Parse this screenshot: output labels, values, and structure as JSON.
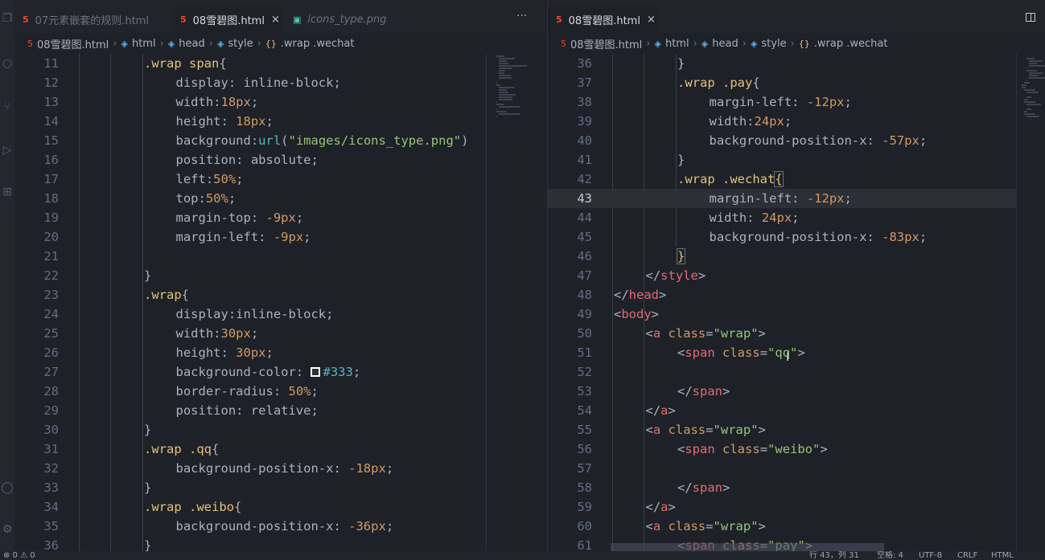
{
  "left_pane": {
    "tabs": [
      {
        "label": "07元素嵌套的规则.html",
        "icon": "html5-icon",
        "active": false
      },
      {
        "label": "08雪碧图.html",
        "icon": "html5-icon",
        "active": true,
        "close": "×"
      },
      {
        "label": "icons_type.png",
        "icon": "image-icon",
        "active": false,
        "italic": true
      }
    ],
    "more": "···",
    "breadcrumbs": [
      "08雪碧图.html",
      "html",
      "head",
      "style",
      ".wrap .wechat"
    ],
    "lines": [
      {
        "n": "11",
        "indent": 2,
        "tokens": [
          {
            "t": ".wrap span",
            "c": "sel"
          },
          {
            "t": "{",
            "c": "prop"
          }
        ]
      },
      {
        "n": "12",
        "indent": 3,
        "tokens": [
          {
            "t": "display: inline-block;",
            "c": "prop"
          }
        ]
      },
      {
        "n": "13",
        "indent": 3,
        "tokens": [
          {
            "t": "width:",
            "c": "prop"
          },
          {
            "t": "18px",
            "c": "num"
          },
          {
            "t": ";",
            "c": "prop"
          }
        ]
      },
      {
        "n": "14",
        "indent": 3,
        "tokens": [
          {
            "t": "height: ",
            "c": "prop"
          },
          {
            "t": "18px",
            "c": "num"
          },
          {
            "t": ";",
            "c": "prop"
          }
        ]
      },
      {
        "n": "15",
        "indent": 3,
        "tokens": [
          {
            "t": "background:",
            "c": "prop"
          },
          {
            "t": "url",
            "c": "kw"
          },
          {
            "t": "(",
            "c": "prop"
          },
          {
            "t": "\"images/icons_type.png\"",
            "c": "str"
          },
          {
            "t": ")",
            "c": "prop"
          }
        ]
      },
      {
        "n": "16",
        "indent": 3,
        "tokens": [
          {
            "t": "position: absolute;",
            "c": "prop"
          }
        ]
      },
      {
        "n": "17",
        "indent": 3,
        "tokens": [
          {
            "t": "left:",
            "c": "prop"
          },
          {
            "t": "50%",
            "c": "num"
          },
          {
            "t": ";",
            "c": "prop"
          }
        ]
      },
      {
        "n": "18",
        "indent": 3,
        "tokens": [
          {
            "t": "top:",
            "c": "prop"
          },
          {
            "t": "50%",
            "c": "num"
          },
          {
            "t": ";",
            "c": "prop"
          }
        ]
      },
      {
        "n": "19",
        "indent": 3,
        "tokens": [
          {
            "t": "margin-top: ",
            "c": "prop"
          },
          {
            "t": "-9px",
            "c": "num"
          },
          {
            "t": ";",
            "c": "prop"
          }
        ]
      },
      {
        "n": "20",
        "indent": 3,
        "tokens": [
          {
            "t": "margin-left: ",
            "c": "prop"
          },
          {
            "t": "-9px",
            "c": "num"
          },
          {
            "t": ";",
            "c": "prop"
          }
        ]
      },
      {
        "n": "21",
        "indent": 0,
        "tokens": []
      },
      {
        "n": "22",
        "indent": 2,
        "tokens": [
          {
            "t": "}",
            "c": "prop"
          }
        ]
      },
      {
        "n": "23",
        "indent": 2,
        "tokens": [
          {
            "t": ".wrap",
            "c": "sel"
          },
          {
            "t": "{",
            "c": "prop"
          }
        ]
      },
      {
        "n": "24",
        "indent": 3,
        "tokens": [
          {
            "t": "display:inline-block;",
            "c": "prop"
          }
        ]
      },
      {
        "n": "25",
        "indent": 3,
        "tokens": [
          {
            "t": "width:",
            "c": "prop"
          },
          {
            "t": "30px",
            "c": "num"
          },
          {
            "t": ";",
            "c": "prop"
          }
        ]
      },
      {
        "n": "26",
        "indent": 3,
        "tokens": [
          {
            "t": "height: ",
            "c": "prop"
          },
          {
            "t": "30px",
            "c": "num"
          },
          {
            "t": ";",
            "c": "prop"
          }
        ]
      },
      {
        "n": "27",
        "indent": 3,
        "tokens": [
          {
            "t": "background-color: ",
            "c": "prop"
          },
          {
            "t": "",
            "c": "swatch"
          },
          {
            "t": "#333",
            "c": "kw"
          },
          {
            "t": ";",
            "c": "prop"
          }
        ]
      },
      {
        "n": "28",
        "indent": 3,
        "tokens": [
          {
            "t": "border-radius: ",
            "c": "prop"
          },
          {
            "t": "50%",
            "c": "num"
          },
          {
            "t": ";",
            "c": "prop"
          }
        ]
      },
      {
        "n": "29",
        "indent": 3,
        "tokens": [
          {
            "t": "position: relative;",
            "c": "prop"
          }
        ]
      },
      {
        "n": "30",
        "indent": 2,
        "tokens": [
          {
            "t": "}",
            "c": "prop"
          }
        ]
      },
      {
        "n": "31",
        "indent": 2,
        "tokens": [
          {
            "t": ".wrap .qq",
            "c": "sel"
          },
          {
            "t": "{",
            "c": "prop"
          }
        ]
      },
      {
        "n": "32",
        "indent": 3,
        "tokens": [
          {
            "t": "background-position-x: ",
            "c": "prop"
          },
          {
            "t": "-18px",
            "c": "num"
          },
          {
            "t": ";",
            "c": "prop"
          }
        ]
      },
      {
        "n": "33",
        "indent": 2,
        "tokens": [
          {
            "t": "}",
            "c": "prop"
          }
        ]
      },
      {
        "n": "34",
        "indent": 2,
        "tokens": [
          {
            "t": ".wrap .weibo",
            "c": "sel"
          },
          {
            "t": "{",
            "c": "prop"
          }
        ]
      },
      {
        "n": "35",
        "indent": 3,
        "tokens": [
          {
            "t": "background-position-x: ",
            "c": "prop"
          },
          {
            "t": "-36px",
            "c": "num"
          },
          {
            "t": ";",
            "c": "prop"
          }
        ]
      },
      {
        "n": "36",
        "indent": 2,
        "tokens": [
          {
            "t": "}",
            "c": "prop"
          }
        ]
      }
    ]
  },
  "right_pane": {
    "tabs": [
      {
        "label": "08雪碧图.html",
        "icon": "html5-icon",
        "active": true,
        "close": "×"
      }
    ],
    "breadcrumbs": [
      "08雪碧图.html",
      "html",
      "head",
      "style",
      ".wrap .wechat"
    ],
    "lines": [
      {
        "n": "36",
        "indent": 2,
        "tokens": [
          {
            "t": "}",
            "c": "prop"
          }
        ]
      },
      {
        "n": "37",
        "indent": 2,
        "tokens": [
          {
            "t": ".wrap .pay",
            "c": "sel"
          },
          {
            "t": "{",
            "c": "prop"
          }
        ]
      },
      {
        "n": "38",
        "indent": 3,
        "tokens": [
          {
            "t": "margin-left: ",
            "c": "prop"
          },
          {
            "t": "-12px",
            "c": "num"
          },
          {
            "t": ";",
            "c": "prop"
          }
        ]
      },
      {
        "n": "39",
        "indent": 3,
        "tokens": [
          {
            "t": "width:",
            "c": "prop"
          },
          {
            "t": "24px",
            "c": "num"
          },
          {
            "t": ";",
            "c": "prop"
          }
        ]
      },
      {
        "n": "40",
        "indent": 3,
        "tokens": [
          {
            "t": "background-position-x: ",
            "c": "prop"
          },
          {
            "t": "-57px",
            "c": "num"
          },
          {
            "t": ";",
            "c": "prop"
          }
        ]
      },
      {
        "n": "41",
        "indent": 2,
        "tokens": [
          {
            "t": "}",
            "c": "prop"
          }
        ]
      },
      {
        "n": "42",
        "indent": 2,
        "tokens": [
          {
            "t": ".wrap .wechat",
            "c": "sel"
          },
          {
            "t": "{",
            "c": "br"
          }
        ]
      },
      {
        "n": "43",
        "indent": 3,
        "current": true,
        "tokens": [
          {
            "t": "margin-left: ",
            "c": "prop"
          },
          {
            "t": "-12px",
            "c": "num"
          },
          {
            "t": ";",
            "c": "prop"
          }
        ]
      },
      {
        "n": "44",
        "indent": 3,
        "tokens": [
          {
            "t": "width: ",
            "c": "prop"
          },
          {
            "t": "24px",
            "c": "num"
          },
          {
            "t": ";",
            "c": "prop"
          }
        ]
      },
      {
        "n": "45",
        "indent": 3,
        "tokens": [
          {
            "t": "background-position-x: ",
            "c": "prop"
          },
          {
            "t": "-83px",
            "c": "num"
          },
          {
            "t": ";",
            "c": "prop"
          }
        ]
      },
      {
        "n": "46",
        "indent": 2,
        "tokens": [
          {
            "t": "}",
            "c": "br"
          }
        ]
      },
      {
        "n": "47",
        "indent": 1,
        "tokens": [
          {
            "t": "</",
            "c": "prop"
          },
          {
            "t": "style",
            "c": "tag"
          },
          {
            "t": ">",
            "c": "prop"
          }
        ]
      },
      {
        "n": "48",
        "indent": 0,
        "tokens": [
          {
            "t": "</",
            "c": "prop"
          },
          {
            "t": "head",
            "c": "tag"
          },
          {
            "t": ">",
            "c": "prop"
          }
        ]
      },
      {
        "n": "49",
        "indent": 0,
        "tokens": [
          {
            "t": "<",
            "c": "prop"
          },
          {
            "t": "body",
            "c": "tag"
          },
          {
            "t": ">",
            "c": "prop"
          }
        ]
      },
      {
        "n": "50",
        "indent": 1,
        "tokens": [
          {
            "t": "<",
            "c": "prop"
          },
          {
            "t": "a",
            "c": "tag"
          },
          {
            "t": " ",
            "c": "prop"
          },
          {
            "t": "class",
            "c": "attr"
          },
          {
            "t": "=",
            "c": "prop"
          },
          {
            "t": "\"wrap\"",
            "c": "str"
          },
          {
            "t": ">",
            "c": "prop"
          }
        ]
      },
      {
        "n": "51",
        "indent": 2,
        "tokens": [
          {
            "t": "<",
            "c": "prop"
          },
          {
            "t": "span",
            "c": "tag"
          },
          {
            "t": " ",
            "c": "prop"
          },
          {
            "t": "class",
            "c": "attr"
          },
          {
            "t": "=",
            "c": "prop"
          },
          {
            "t": "\"qq\"",
            "c": "str"
          },
          {
            "t": ">",
            "c": "prop"
          }
        ]
      },
      {
        "n": "52",
        "indent": 0,
        "tokens": []
      },
      {
        "n": "53",
        "indent": 2,
        "tokens": [
          {
            "t": "</",
            "c": "prop"
          },
          {
            "t": "span",
            "c": "tag"
          },
          {
            "t": ">",
            "c": "prop"
          }
        ]
      },
      {
        "n": "54",
        "indent": 1,
        "tokens": [
          {
            "t": "</",
            "c": "prop"
          },
          {
            "t": "a",
            "c": "tag"
          },
          {
            "t": ">",
            "c": "prop"
          }
        ]
      },
      {
        "n": "55",
        "indent": 1,
        "tokens": [
          {
            "t": "<",
            "c": "prop"
          },
          {
            "t": "a",
            "c": "tag"
          },
          {
            "t": " ",
            "c": "prop"
          },
          {
            "t": "class",
            "c": "attr"
          },
          {
            "t": "=",
            "c": "prop"
          },
          {
            "t": "\"wrap\"",
            "c": "str"
          },
          {
            "t": ">",
            "c": "prop"
          }
        ]
      },
      {
        "n": "56",
        "indent": 2,
        "tokens": [
          {
            "t": "<",
            "c": "prop"
          },
          {
            "t": "span",
            "c": "tag"
          },
          {
            "t": " ",
            "c": "prop"
          },
          {
            "t": "class",
            "c": "attr"
          },
          {
            "t": "=",
            "c": "prop"
          },
          {
            "t": "\"weibo\"",
            "c": "str"
          },
          {
            "t": ">",
            "c": "prop"
          }
        ]
      },
      {
        "n": "57",
        "indent": 0,
        "tokens": []
      },
      {
        "n": "58",
        "indent": 2,
        "tokens": [
          {
            "t": "</",
            "c": "prop"
          },
          {
            "t": "span",
            "c": "tag"
          },
          {
            "t": ">",
            "c": "prop"
          }
        ]
      },
      {
        "n": "59",
        "indent": 1,
        "tokens": [
          {
            "t": "</",
            "c": "prop"
          },
          {
            "t": "a",
            "c": "tag"
          },
          {
            "t": ">",
            "c": "prop"
          }
        ]
      },
      {
        "n": "60",
        "indent": 1,
        "tokens": [
          {
            "t": "<",
            "c": "prop"
          },
          {
            "t": "a",
            "c": "tag"
          },
          {
            "t": " ",
            "c": "prop"
          },
          {
            "t": "class",
            "c": "attr"
          },
          {
            "t": "=",
            "c": "prop"
          },
          {
            "t": "\"wrap\"",
            "c": "str"
          },
          {
            "t": ">",
            "c": "prop"
          }
        ]
      },
      {
        "n": "61",
        "indent": 2,
        "tokens": [
          {
            "t": "<",
            "c": "prop"
          },
          {
            "t": "span",
            "c": "tag"
          },
          {
            "t": " ",
            "c": "prop"
          },
          {
            "t": "class",
            "c": "attr"
          },
          {
            "t": "=",
            "c": "prop"
          },
          {
            "t": "\"pay\"",
            "c": "str"
          },
          {
            "t": ">",
            "c": "prop"
          }
        ]
      }
    ]
  },
  "status_bar": {
    "problems": "⊗ 0 ⚠ 0",
    "position": "行 43，列 31",
    "spaces": "空格: 4",
    "encoding": "UTF-8",
    "eol": "CRLF",
    "language": "HTML"
  },
  "colors": {
    "editor_bg": "#1e2128",
    "tab_bar_bg": "#21252b",
    "selector": "#e5c07b",
    "number": "#d19a66",
    "string": "#98c379",
    "tag": "#e06c75",
    "keyword": "#56b6c2"
  },
  "activity_icons": [
    "files-icon",
    "search-icon",
    "source-control-icon",
    "run-icon",
    "extensions-icon",
    "account-icon",
    "settings-icon"
  ]
}
